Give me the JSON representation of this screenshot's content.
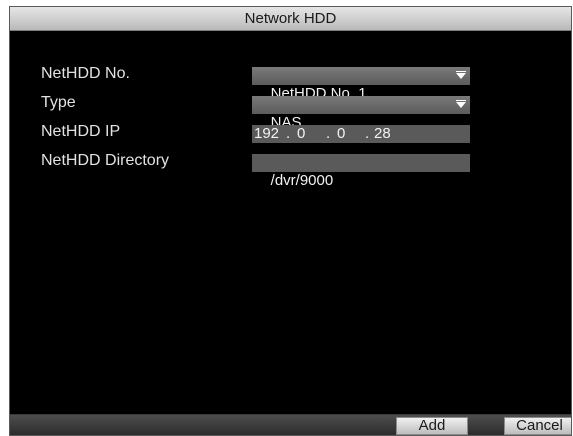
{
  "dialog": {
    "title": "Network HDD"
  },
  "form": {
    "netHDDNo": {
      "label": "NetHDD No.",
      "value": "NetHDD No. 1"
    },
    "type": {
      "label": "Type",
      "value": "NAS"
    },
    "netHDDIP": {
      "label": "NetHDD IP",
      "octets": [
        "192",
        ".",
        "0",
        ".",
        "0",
        ".",
        "28"
      ]
    },
    "netHDDDirectory": {
      "label": "NetHDD Directory",
      "value": "/dvr/9000"
    }
  },
  "buttons": {
    "add": "Add",
    "cancel": "Cancel"
  }
}
